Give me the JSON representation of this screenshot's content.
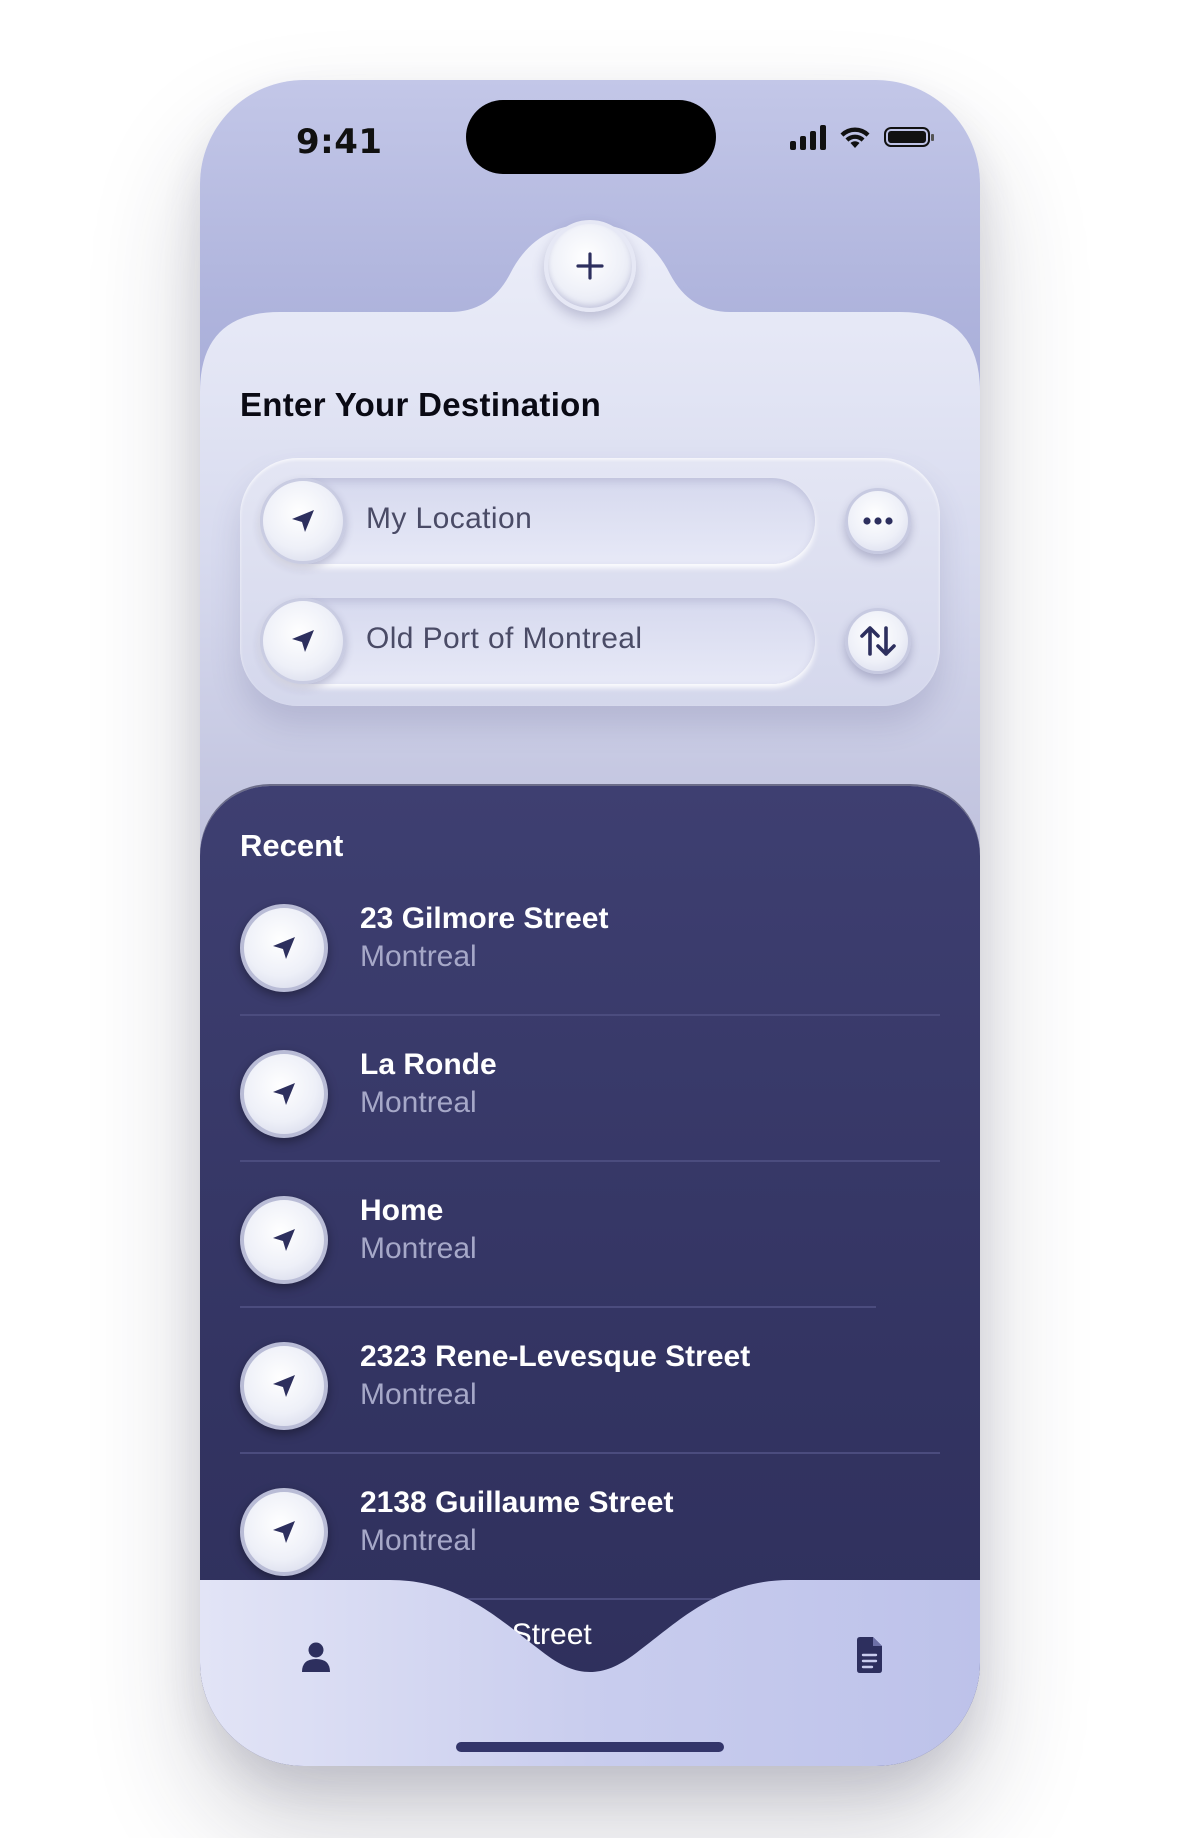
{
  "status_bar": {
    "time": "9:41",
    "icons": [
      "signal-icon",
      "wifi-icon",
      "battery-icon"
    ]
  },
  "header": {
    "add_icon": "plus-icon",
    "title": "Enter Your Destination"
  },
  "route": {
    "from": {
      "value": "My Location",
      "icon": "navigation-arrow-icon",
      "action_icon": "more-icon"
    },
    "to": {
      "value": "Old Port of Montreal",
      "icon": "navigation-arrow-icon",
      "action_icon": "swap-icon"
    }
  },
  "recent": {
    "title": "Recent",
    "items": [
      {
        "name": "23 Gilmore Street",
        "city": "Montreal"
      },
      {
        "name": "La Ronde",
        "city": "Montreal"
      },
      {
        "name": "Home",
        "city": "Montreal"
      },
      {
        "name": "2323 Rene-Levesque Street",
        "city": "Montreal"
      },
      {
        "name": "2138 Guillaume Street",
        "city": "Montreal"
      }
    ],
    "partial_item": "ore Street"
  },
  "tab_bar": {
    "left_icon": "user-icon",
    "right_icon": "document-icon"
  },
  "colors": {
    "accent_dark": "#34356a",
    "panel_light": "#e4e6f4",
    "background_lilac": "#aeb3dc"
  }
}
